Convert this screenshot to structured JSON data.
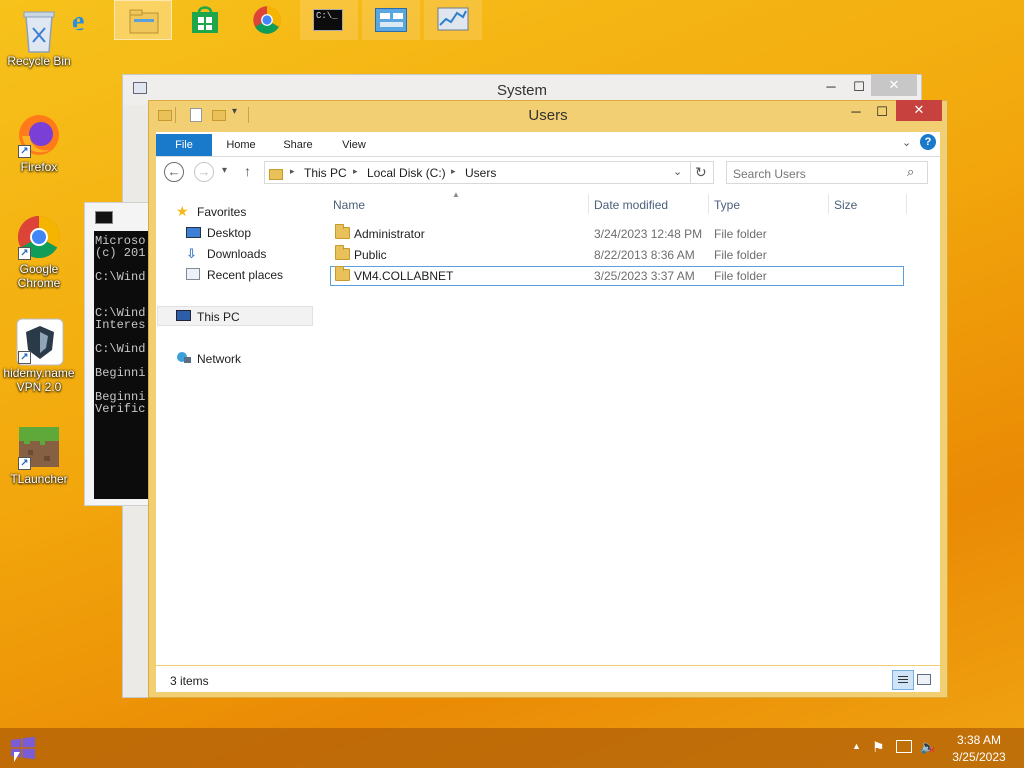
{
  "desktop": {
    "icons": [
      {
        "label": "Recycle Bin"
      },
      {
        "label": "Firefox"
      },
      {
        "label": "Google Chrome"
      },
      {
        "label": "hidemy.name VPN 2.0"
      },
      {
        "label": "TLauncher"
      }
    ]
  },
  "system_window": {
    "title": "System"
  },
  "cmd_window": {
    "lines": [
      "Microso",
      "(c) 201",
      "C:\\Wind",
      "C:\\Wind",
      "Interes",
      "C:\\Wind",
      "Beginni",
      "Beginni",
      "Verific"
    ]
  },
  "explorer": {
    "title": "Users",
    "ribbon": {
      "file": "File",
      "home": "Home",
      "share": "Share",
      "view": "View"
    },
    "address": {
      "segments": [
        "This PC",
        "Local Disk (C:)",
        "Users"
      ]
    },
    "search": {
      "placeholder": "Search Users"
    },
    "nav": {
      "favorites": "Favorites",
      "desktop": "Desktop",
      "downloads": "Downloads",
      "recent": "Recent places",
      "this_pc": "This PC",
      "network": "Network"
    },
    "columns": {
      "name": "Name",
      "date": "Date modified",
      "type": "Type",
      "size": "Size"
    },
    "files": [
      {
        "name": "Administrator",
        "date": "3/24/2023 12:48 PM",
        "type": "File folder"
      },
      {
        "name": "Public",
        "date": "8/22/2013 8:36 AM",
        "type": "File folder"
      },
      {
        "name": "VM4.COLLABNET",
        "date": "3/25/2023 3:37 AM",
        "type": "File folder"
      }
    ],
    "status": {
      "items": "3 items"
    }
  },
  "taskbar": {
    "clock": {
      "time": "3:38 AM",
      "date": "3/25/2023"
    }
  },
  "colors": {
    "accent": "#1979ca",
    "window_frame": "#f3cf73",
    "desktop": "#f2a70c"
  }
}
